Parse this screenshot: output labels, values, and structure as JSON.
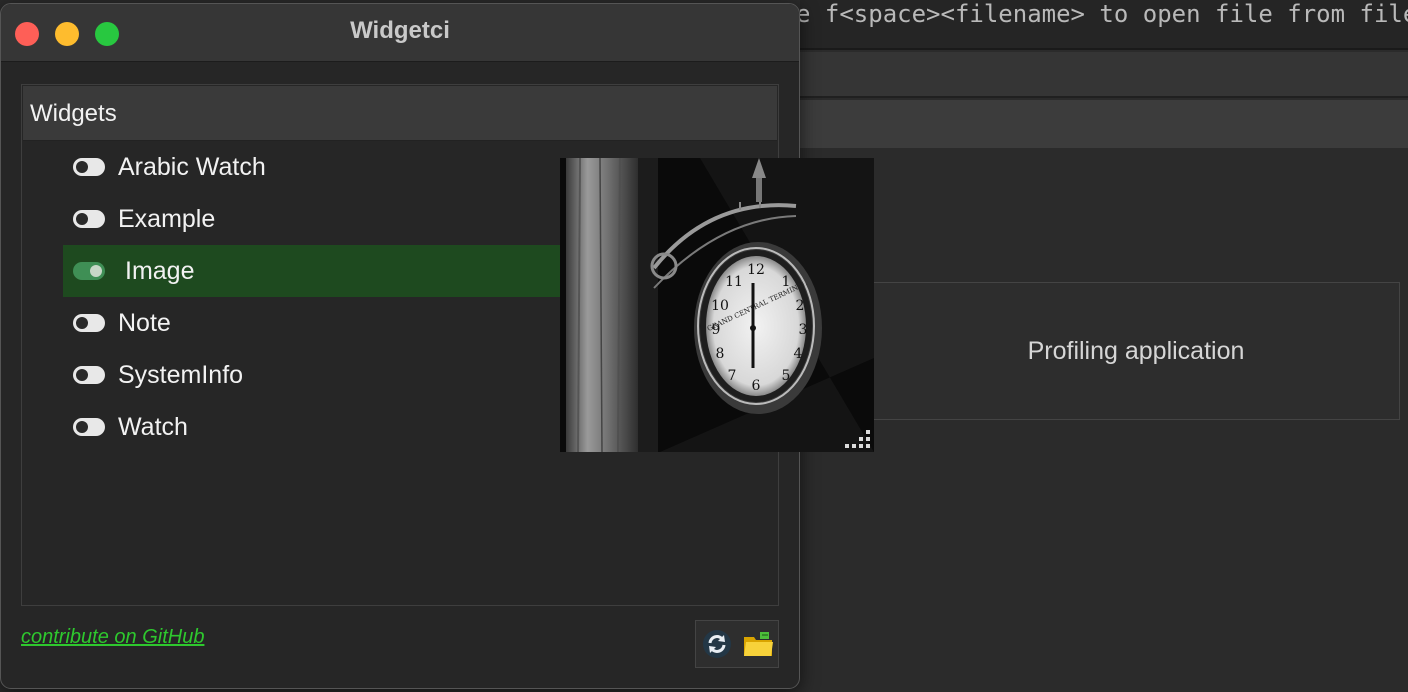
{
  "background": {
    "hint_text": "e f<space><filename> to open file from file sy",
    "profiling_text": "Profiling application"
  },
  "window": {
    "title": "Widgetci",
    "panel_header": "Widgets",
    "items": [
      {
        "label": "Arabic Watch",
        "enabled": false
      },
      {
        "label": "Example",
        "enabled": false
      },
      {
        "label": "Image",
        "enabled": true
      },
      {
        "label": "Note",
        "enabled": false
      },
      {
        "label": "SystemInfo",
        "enabled": false
      },
      {
        "label": "Watch",
        "enabled": false
      }
    ],
    "footer_link": "contribute on GitHub",
    "icons": [
      "refresh-icon",
      "folder-icon"
    ]
  },
  "image_widget": {
    "icon": "clock-photo",
    "clock_text": "GRAND CENTRAL TERMINAL"
  },
  "colors": {
    "selected_row": "#1e4a1f",
    "link": "#2ec82e",
    "toggle_on": "#3f8f55"
  }
}
